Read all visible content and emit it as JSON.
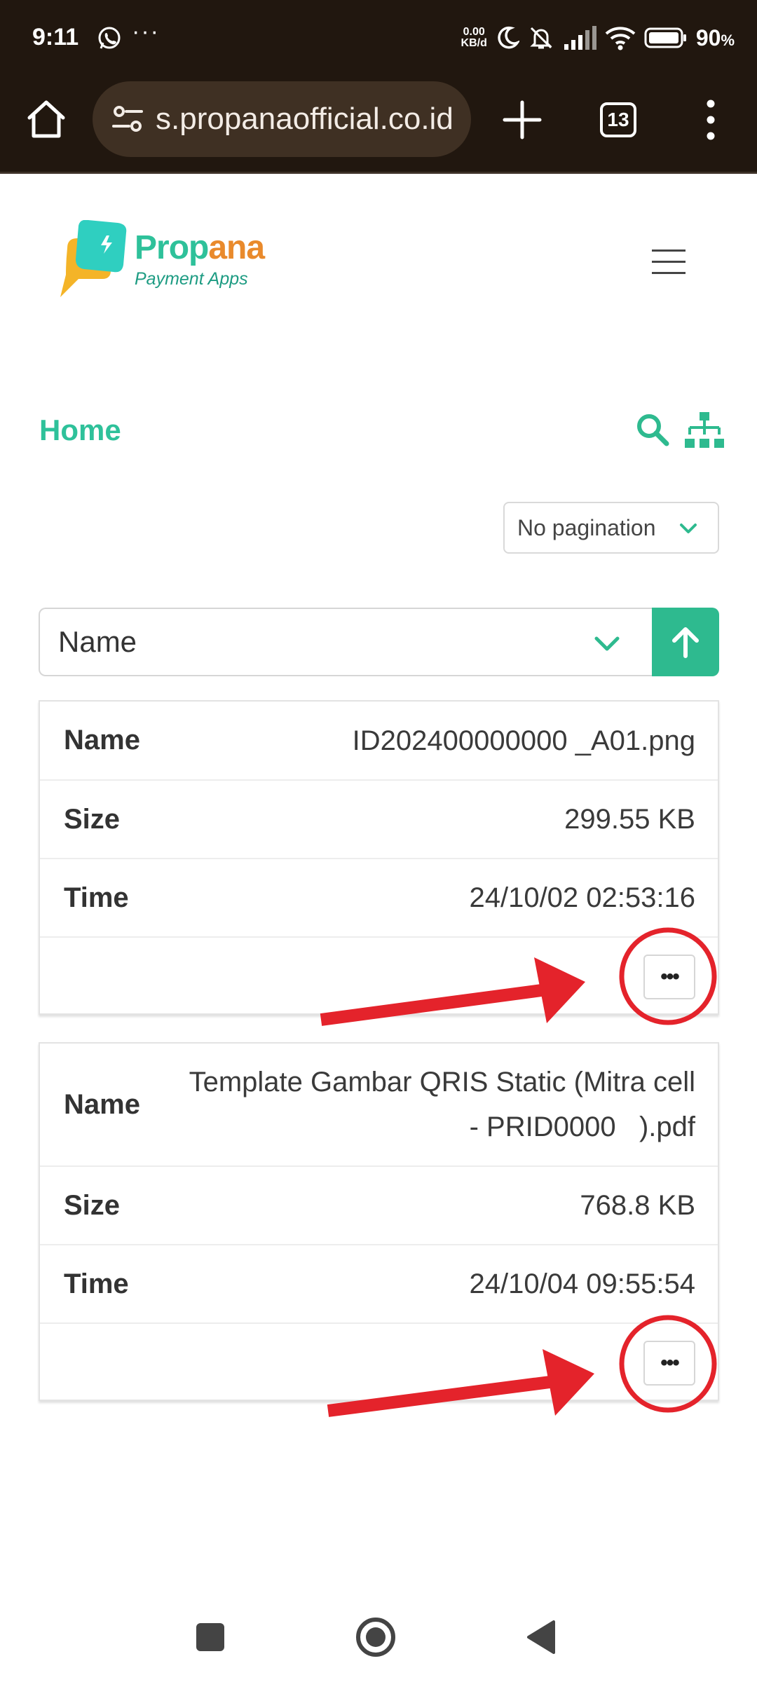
{
  "status_bar": {
    "time": "9:11",
    "dots": "···",
    "net_speed_value": "0.00",
    "net_speed_unit": "KB/d",
    "battery_percent": "90",
    "battery_suffix": "%"
  },
  "browser": {
    "url": "s.propanaofficial.co.id",
    "tab_count": "13"
  },
  "brand": {
    "name_part1": "Prop",
    "name_part2": "ana",
    "tagline": "Payment Apps",
    "color_primary": "#2ec19a",
    "color_accent": "#e98a2c"
  },
  "nav": {
    "home_label": "Home"
  },
  "pagination": {
    "selected": "No pagination"
  },
  "sort": {
    "field": "Name"
  },
  "labels": {
    "name": "Name",
    "size": "Size",
    "time": "Time",
    "more": "•••"
  },
  "files": [
    {
      "name": "ID202400000000 _A01.png",
      "size": "299.55 KB",
      "time": "24/10/02 02:53:16"
    },
    {
      "name": "Template Gambar QRIS Static (Mitra cell - PRID0000   ).pdf",
      "size": "768.8 KB",
      "time": "24/10/04 09:55:54"
    }
  ],
  "annotation_color": "#e4232b"
}
